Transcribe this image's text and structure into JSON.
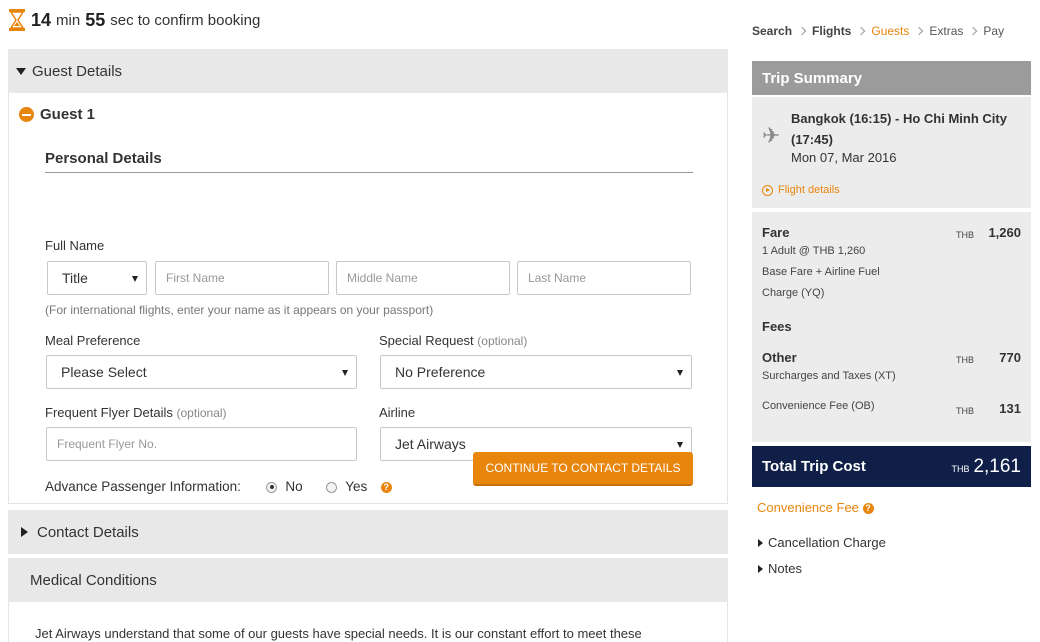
{
  "timer": {
    "minutes": "14",
    "min_label": "min",
    "seconds": "55",
    "sec_label": "sec to confirm booking"
  },
  "guest_details": {
    "header": "Guest Details",
    "guest_label": "Guest 1",
    "personal_details_title": "Personal Details",
    "full_name_label": "Full Name",
    "title_select": "Title",
    "first_name_placeholder": "First Name",
    "middle_name_placeholder": "Middle Name",
    "last_name_placeholder": "Last Name",
    "name_hint": "(For international flights, enter your name as it appears on your passport)",
    "meal_label": "Meal Preference",
    "meal_value": "Please Select",
    "special_label": "Special Request",
    "optional": "(optional)",
    "special_value": "No Preference",
    "ff_label": "Frequent Flyer Details",
    "ff_placeholder": "Frequent Flyer No.",
    "airline_label": "Airline",
    "airline_value": "Jet Airways",
    "api_label": "Advance Passenger Information:",
    "api_no": "No",
    "api_yes": "Yes",
    "api_help": "?",
    "continue_button": "CONTINUE TO CONTACT DETAILS"
  },
  "contact_details": {
    "header": "Contact Details"
  },
  "medical": {
    "header": "Medical Conditions",
    "body": "Jet Airways understand that some of our guests have special needs. It is our constant effort to meet these"
  },
  "breadcrumbs": [
    "Search",
    "Flights",
    "Guests",
    "Extras",
    "Pay"
  ],
  "breadcrumbs_active": "Guests",
  "trip_summary": {
    "header": "Trip Summary",
    "route": "Bangkok (16:15) - Ho Chi Minh City (17:45)",
    "date": "Mon 07, Mar 2016",
    "flight_details_link": "Flight details",
    "fare_label": "Fare",
    "fare_currency": "THB",
    "fare_amount": "1,260",
    "fare_detail_1": "1 Adult @ THB 1,260",
    "fare_detail_2": "Base Fare + Airline Fuel Charge (YQ)",
    "fees_label": "Fees",
    "other_label": "Other",
    "other_currency": "THB",
    "other_amount": "770",
    "other_detail": "Surcharges and Taxes (XT)",
    "conv_label": "Convenience Fee (OB)",
    "conv_currency": "THB",
    "conv_amount": "131",
    "total_label": "Total Trip Cost",
    "total_currency": "THB",
    "total_amount": "2,161"
  },
  "convenience_fee_link": "Convenience Fee",
  "convenience_help": "?",
  "cancellation_link": "Cancellation Charge",
  "notes_link": "Notes",
  "colors": {
    "accent": "#e8850c",
    "total_bg": "#0f1f47",
    "summary_head": "#9b9b9b"
  }
}
